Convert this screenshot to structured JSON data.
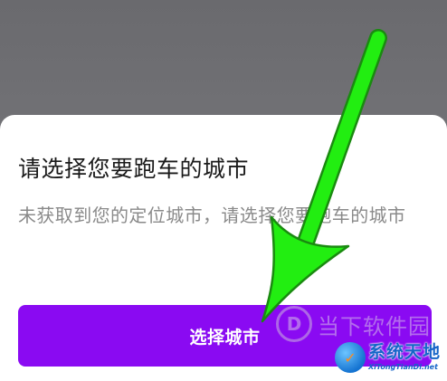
{
  "dialog": {
    "title": "请选择您要跑车的城市",
    "message": "未获取到您的定位城市，请选择您要跑车的城市",
    "primary_button_label": "选择城市"
  },
  "annotation": {
    "arrow_color": "#22ee11",
    "arrow_outline": "#1a8a10"
  },
  "watermarks": {
    "site1_text": "当下软件园",
    "site2_cn": "系统天地",
    "site2_en": "XiTongTianDi.net"
  },
  "colors": {
    "primary_button": "#8a0af2",
    "backdrop": "#6f6f73",
    "title_text": "#1a1a1a",
    "message_text": "#8a8a8a"
  },
  "icons": {
    "site1_logo": "downxia-logo-icon",
    "site2_logo": "xitongtiandi-globe-icon"
  }
}
